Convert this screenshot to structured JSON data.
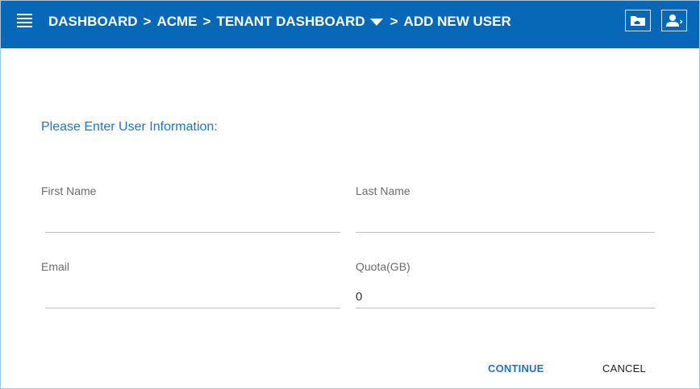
{
  "header": {
    "breadcrumb": [
      {
        "label": "DASHBOARD"
      },
      {
        "label": "ACME"
      },
      {
        "label": "TENANT DASHBOARD"
      },
      {
        "label": "ADD NEW USER"
      }
    ],
    "separator": ">",
    "icons": [
      "menu-icon",
      "cloud-folder-icon",
      "user-account-icon"
    ]
  },
  "form": {
    "heading": "Please Enter User Information:",
    "first_name": {
      "label": "First Name",
      "value": ""
    },
    "last_name": {
      "label": "Last Name",
      "value": ""
    },
    "email": {
      "label": "Email",
      "value": ""
    },
    "quota": {
      "label": "Quota(GB)",
      "value": "0"
    }
  },
  "actions": {
    "continue_label": "CONTINUE",
    "cancel_label": "CANCEL"
  },
  "colors": {
    "header_bg": "#0668b6",
    "accent": "#1f74c2"
  }
}
